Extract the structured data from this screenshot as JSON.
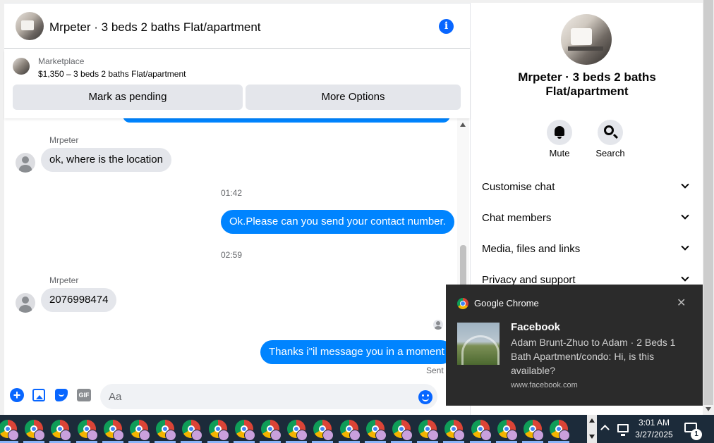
{
  "header": {
    "title": "Mrpeter · 3 beds 2 baths Flat/apartment",
    "info_glyph": "i"
  },
  "marketplace": {
    "label": "Marketplace",
    "listing": "$1,350 – 3 beds 2 baths Flat/apartment",
    "mark_pending_label": "Mark as pending",
    "more_options_label": "More Options"
  },
  "messages": {
    "sender_name_1": "Mrpeter",
    "incoming_1": "ok, where is the location",
    "time_1": "01:42",
    "outgoing_1": "Ok.Please can you send your contact number.",
    "time_2": "02:59",
    "sender_name_2": "Mrpeter",
    "incoming_2": "2076998474",
    "outgoing_2": "Thanks i\"il message you in a moment",
    "status": "Sent"
  },
  "composer": {
    "placeholder": "Aa",
    "plus_glyph": "+",
    "gif_label": "GIF"
  },
  "panel": {
    "title": "Mrpeter · 3 beds 2 baths Flat/apartment",
    "mute_label": "Mute",
    "search_label": "Search",
    "sections": [
      "Customise chat",
      "Chat members",
      "Media, files and links",
      "Privacy and support"
    ]
  },
  "notification": {
    "app": "Google Chrome",
    "close_glyph": "✕",
    "title": "Facebook",
    "body": "Adam Brunt-Zhuo to Adam · 2 Beds 1 Bath Apartment/condo: Hi, is this available?",
    "site": "www.facebook.com"
  },
  "taskbar": {
    "time": "3:01 AM",
    "date": "3/27/2025",
    "notification_count": "1"
  },
  "colors": {
    "accent": "#0866ff",
    "outgoing_bubble": "#0084ff",
    "incoming_bubble": "#e4e6eb",
    "taskbar": "#1c2b3a",
    "toast": "#2b2b2b"
  }
}
